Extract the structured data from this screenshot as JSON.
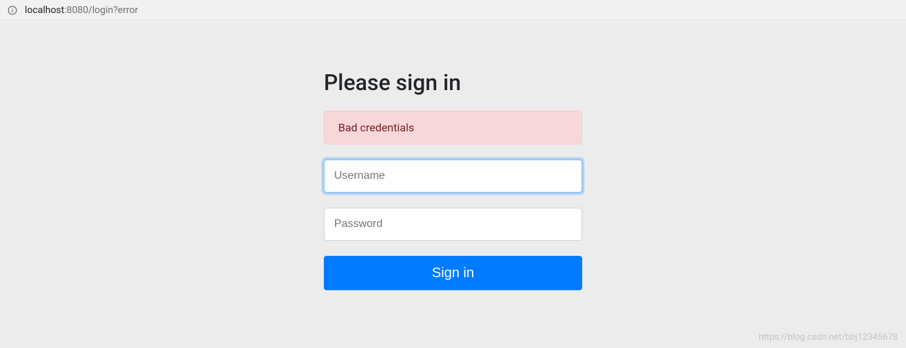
{
  "browser": {
    "url_host": "localhost",
    "url_rest": ":8080/login?error"
  },
  "form": {
    "title": "Please sign in",
    "error_message": "Bad credentials",
    "username_placeholder": "Username",
    "username_value": "",
    "password_placeholder": "Password",
    "password_value": "",
    "submit_label": "Sign in"
  },
  "watermark": "https://blog.csdn.net/bbj12345678"
}
